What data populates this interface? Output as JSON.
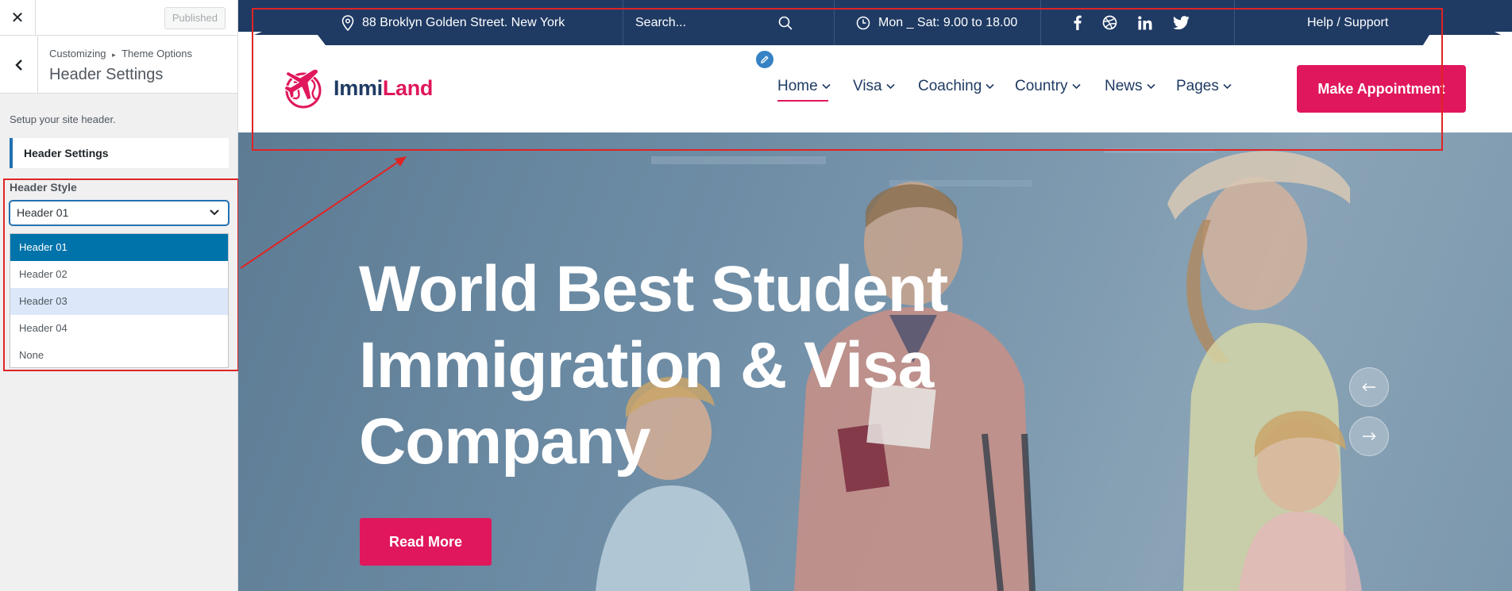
{
  "customizer": {
    "close_glyph": "✕",
    "published_label": "Published",
    "breadcrumb": [
      "Customizing",
      "Theme Options"
    ],
    "breadcrumb_separator": "▸",
    "panel_title": "Header Settings",
    "description": "Setup your site header.",
    "section_label": "Header Settings",
    "header_style": {
      "label": "Header Style",
      "selected": "Header 01",
      "options": [
        "Header 01",
        "Header 02",
        "Header 03",
        "Header 04",
        "None"
      ],
      "highlighted_option": "Header 01",
      "hovered_option": "Header 03"
    }
  },
  "site": {
    "topbar": {
      "address": "88 Broklyn Golden Street. New York",
      "search_placeholder": "Search...",
      "hours": "Mon _ Sat: 9.00 to 18.00",
      "social": [
        "facebook-icon",
        "dribbble-icon",
        "linkedin-icon",
        "twitter-icon"
      ],
      "help": "Help / Support"
    },
    "logo": {
      "part1": "Immi",
      "part2": "Land"
    },
    "nav": [
      "Home",
      "Visa",
      "Coaching",
      "Country",
      "News",
      "Pages"
    ],
    "active_nav": "Home",
    "cta": "Make Appointment",
    "hero": {
      "title_lines": [
        "World Best Student",
        "Immigration & Visa",
        "Company"
      ],
      "button": "Read More"
    }
  },
  "colors": {
    "brand_pink": "#e0175c",
    "navy": "#1f3b64",
    "wp_blue": "#0073aa",
    "annotation_red": "#e02424"
  }
}
